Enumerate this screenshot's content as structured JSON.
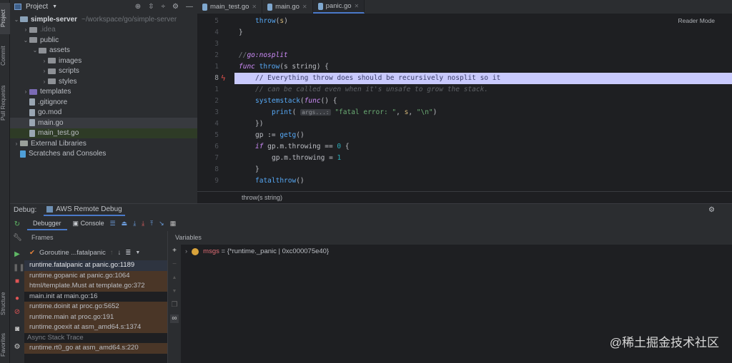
{
  "side_tabs": {
    "project": "Project",
    "commit": "Commit",
    "pull_requests": "Pull Requests",
    "structure": "Structure",
    "favorites": "Favorites"
  },
  "project": {
    "title": "Project",
    "root": "simple-server",
    "root_path": "~/workspace/go/simple-server",
    "items": [
      {
        "label": ".idea",
        "indent": 1,
        "type": "folder",
        "expand": "closed"
      },
      {
        "label": "public",
        "indent": 1,
        "type": "folder",
        "expand": "open"
      },
      {
        "label": "assets",
        "indent": 2,
        "type": "folder",
        "expand": "open"
      },
      {
        "label": "images",
        "indent": 3,
        "type": "folder",
        "expand": "closed"
      },
      {
        "label": "scripts",
        "indent": 3,
        "type": "folder",
        "expand": "closed"
      },
      {
        "label": "styles",
        "indent": 3,
        "type": "folder",
        "expand": "closed"
      },
      {
        "label": "templates",
        "indent": 1,
        "type": "folder",
        "expand": "closed"
      },
      {
        "label": ".gitignore",
        "indent": 1,
        "type": "file"
      },
      {
        "label": "go.mod",
        "indent": 1,
        "type": "file"
      },
      {
        "label": "main.go",
        "indent": 1,
        "type": "file"
      },
      {
        "label": "main_test.go",
        "indent": 1,
        "type": "file"
      },
      {
        "label": "External Libraries",
        "indent": 0,
        "type": "lib",
        "expand": "closed"
      },
      {
        "label": "Scratches and Consoles",
        "indent": 0,
        "type": "scratch"
      }
    ]
  },
  "editor": {
    "tabs": [
      {
        "label": "main_test.go"
      },
      {
        "label": "main.go"
      },
      {
        "label": "panic.go",
        "active": true
      }
    ],
    "reader_mode": "Reader Mode",
    "breadcrumb": "throw(s string)",
    "line_numbers": [
      "5",
      "4",
      "3",
      "2",
      "1",
      "8",
      "1",
      "2",
      "3",
      "4",
      "5",
      "6",
      "7",
      "8",
      "9"
    ],
    "lines": {
      "l0": "throw",
      "l0b": "s",
      "l2a": "//",
      "l2b": "go:nosplit",
      "l3a": "func",
      "l3b": "throw",
      "l3c": "(s string) {",
      "l5": "// Everything throw does should be recursively nosplit so it",
      "l6": "// can be called even when it's unsafe to grow the stack.",
      "l7a": "systemstack",
      "l7b": "func",
      "l7c": "() {",
      "l8a": "print",
      "l8hint": "args...:",
      "l8s1": "\"fatal error: \"",
      "l8s": "s",
      "l8s2": "\"\\n\"",
      "l9": "})",
      "l10a": "gp := ",
      "l10b": "getg",
      "l10c": "()",
      "l11a": "if",
      "l11b": " gp.m.throwing == ",
      "l11c": "0",
      "l11d": " {",
      "l12a": "gp.m.throwing = ",
      "l12b": "1",
      "l13": "}",
      "l14": "fatalthrow",
      "l14b": "()"
    }
  },
  "debug": {
    "label": "Debug:",
    "session": "AWS Remote Debug",
    "tabs": {
      "debugger": "Debugger",
      "console": "Console"
    },
    "frames_title": "Frames",
    "variables_title": "Variables",
    "thread": "Goroutine ...fatalpanic",
    "frames": [
      {
        "label": "runtime.fatalpanic at panic.go:1189",
        "lib": false,
        "selected": true
      },
      {
        "label": "runtime.gopanic at panic.go:1064",
        "lib": true
      },
      {
        "label": "html/template.Must at template.go:372",
        "lib": true
      },
      {
        "label": "main.init at main.go:16",
        "lib": false
      },
      {
        "label": "runtime.doinit at proc.go:5652",
        "lib": true
      },
      {
        "label": "runtime.main at proc.go:191",
        "lib": true
      },
      {
        "label": "runtime.goexit at asm_amd64.s:1374",
        "lib": true
      }
    ],
    "async_label": "Async Stack Trace",
    "async_frames": [
      {
        "label": "runtime.rt0_go at asm_amd64.s:220"
      }
    ],
    "variable": {
      "name": "msgs",
      "value": " = {*runtime._panic | 0xc000075e40}"
    }
  },
  "watermark": "@稀土掘金技术社区"
}
